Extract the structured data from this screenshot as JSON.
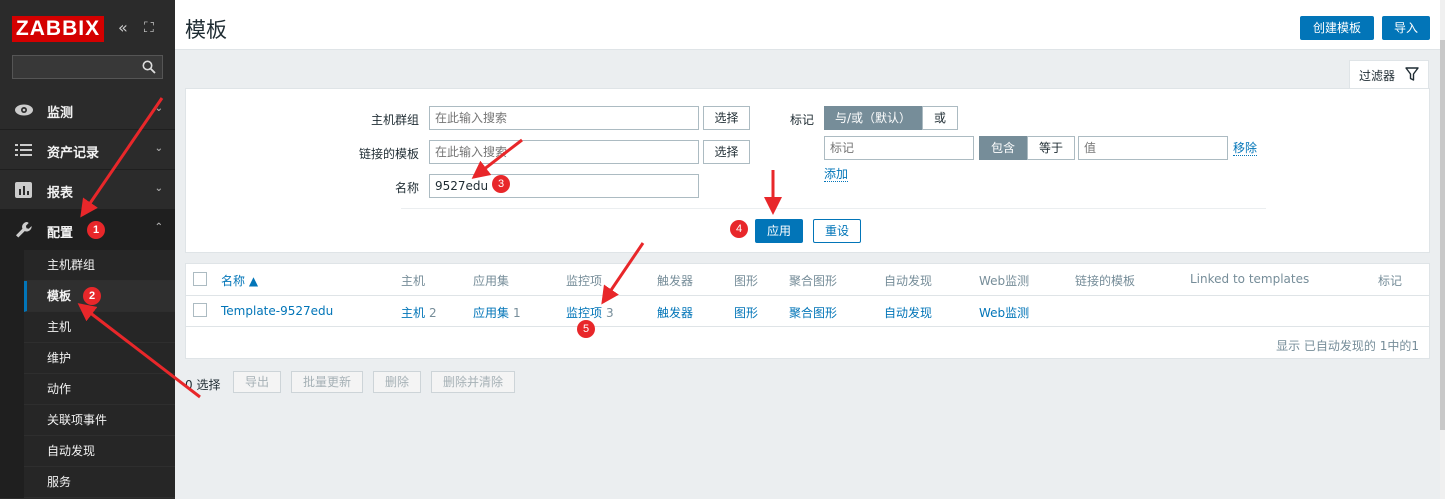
{
  "app": {
    "logo": "ZABBIX"
  },
  "sidebar": {
    "search_placeholder": "",
    "menu": [
      {
        "label": "监测",
        "icon": "eye-icon"
      },
      {
        "label": "资产记录",
        "icon": "list-icon"
      },
      {
        "label": "报表",
        "icon": "bar-chart-icon"
      },
      {
        "label": "配置",
        "icon": "wrench-icon"
      }
    ],
    "submenu": [
      "主机群组",
      "模板",
      "主机",
      "维护",
      "动作",
      "关联项事件",
      "自动发现",
      "服务"
    ]
  },
  "header": {
    "title": "模板",
    "create_button": "创建模板",
    "import_button": "导入"
  },
  "filter": {
    "tab_label": "过滤器",
    "host_group_label": "主机群组",
    "host_group_placeholder": "在此输入搜索",
    "linked_templates_label": "链接的模板",
    "linked_templates_placeholder": "在此输入搜索",
    "name_label": "名称",
    "name_value": "9527edu",
    "select_button": "选择",
    "tags_label": "标记",
    "andor_label": "与/或（默认）",
    "or_label": "或",
    "tag_placeholder": "标记",
    "contains_label": "包含",
    "equals_label": "等于",
    "value_placeholder": "值",
    "remove_link": "移除",
    "add_link": "添加",
    "apply_button": "应用",
    "reset_button": "重设"
  },
  "table": {
    "headers": [
      "名称 ▲",
      "主机",
      "应用集",
      "监控项",
      "触发器",
      "图形",
      "聚合图形",
      "自动发现",
      "Web监测",
      "链接的模板",
      "Linked to templates",
      "标记"
    ],
    "rows": [
      {
        "name": "Template-9527edu",
        "hosts": "主机",
        "hosts_count": "2",
        "apps": "应用集",
        "apps_count": "1",
        "items": "监控项",
        "items_count": "3",
        "triggers": "触发器",
        "graphs": "图形",
        "screens": "聚合图形",
        "discovery": "自动发现",
        "web": "Web监测"
      }
    ],
    "footer": "显示 已自动发现的 1中的1"
  },
  "actions": {
    "selected": "0 选择",
    "export": "导出",
    "mass_update": "批量更新",
    "delete": "删除",
    "delete_clear": "删除并清除"
  },
  "annotations": [
    "1",
    "2",
    "3",
    "4",
    "5"
  ],
  "colors": {
    "accent": "#0275b8",
    "logo": "#d40000",
    "annotation": "#e8272a"
  }
}
